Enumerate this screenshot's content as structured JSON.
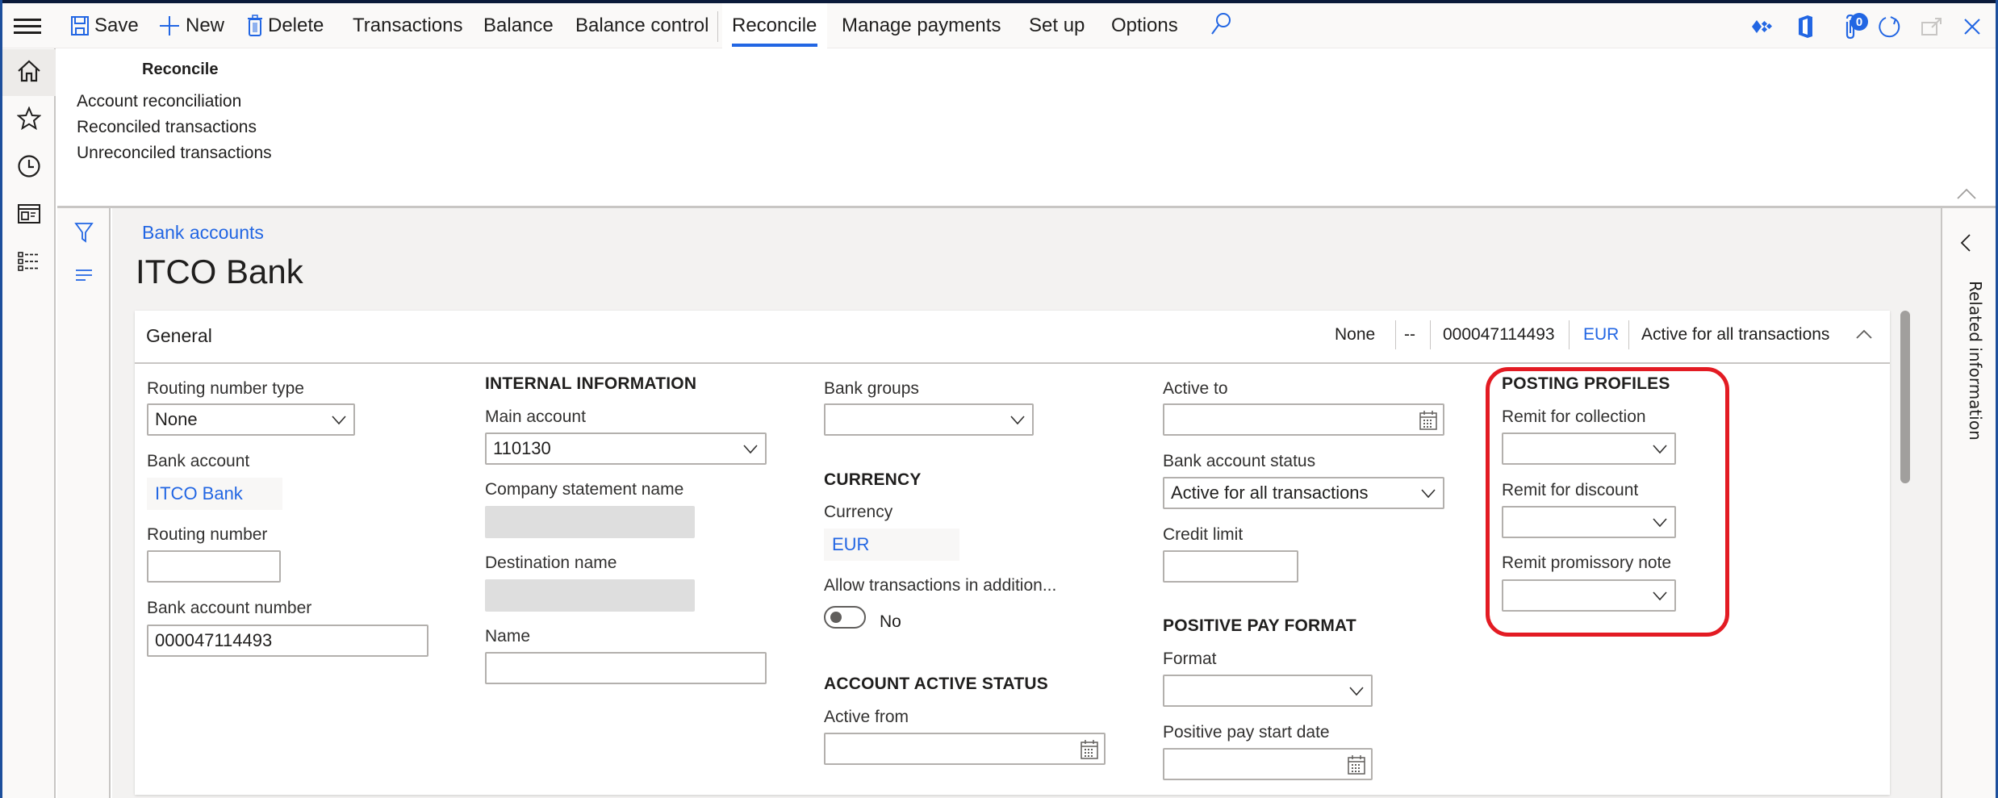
{
  "toolbar": {
    "save": "Save",
    "new": "New",
    "delete": "Delete",
    "transactions": "Transactions",
    "balance": "Balance",
    "balance_control": "Balance control",
    "reconcile": "Reconcile",
    "manage_payments": "Manage payments",
    "set_up": "Set up",
    "options": "Options",
    "attachments_count": "0"
  },
  "flyout": {
    "title": "Reconcile",
    "items": [
      "Account reconciliation",
      "Reconciled transactions",
      "Unreconciled transactions"
    ]
  },
  "breadcrumb": "Bank accounts",
  "page_title": "ITCO Bank",
  "general": {
    "title": "General",
    "summary": [
      "None",
      "--",
      "000047114493",
      "EUR",
      "Active for all transactions"
    ]
  },
  "fields": {
    "routing_number_type": {
      "label": "Routing number type",
      "value": "None"
    },
    "bank_account": {
      "label": "Bank account",
      "value": "ITCO Bank"
    },
    "routing_number": {
      "label": "Routing number",
      "value": ""
    },
    "bank_account_number": {
      "label": "Bank account number",
      "value": "000047114493"
    },
    "internal_information": "INTERNAL INFORMATION",
    "main_account": {
      "label": "Main account",
      "value": "110130"
    },
    "company_statement_name": {
      "label": "Company statement name",
      "value": ""
    },
    "destination_name": {
      "label": "Destination name",
      "value": ""
    },
    "name": {
      "label": "Name",
      "value": ""
    },
    "bank_groups": {
      "label": "Bank groups",
      "value": ""
    },
    "currency_group": "CURRENCY",
    "currency": {
      "label": "Currency",
      "value": "EUR"
    },
    "allow_transactions": {
      "label": "Allow transactions in addition...",
      "value": "No"
    },
    "account_active_status": "ACCOUNT ACTIVE STATUS",
    "active_from": {
      "label": "Active from",
      "value": ""
    },
    "active_to": {
      "label": "Active to",
      "value": ""
    },
    "bank_account_status": {
      "label": "Bank account status",
      "value": "Active for all transactions"
    },
    "credit_limit": {
      "label": "Credit limit",
      "value": ""
    },
    "positive_pay_format": "POSITIVE PAY FORMAT",
    "format": {
      "label": "Format",
      "value": ""
    },
    "positive_pay_start_date": {
      "label": "Positive pay start date",
      "value": ""
    },
    "posting_profiles": "POSTING PROFILES",
    "remit_for_collection": {
      "label": "Remit for collection",
      "value": ""
    },
    "remit_for_discount": {
      "label": "Remit for discount",
      "value": ""
    },
    "remit_promissory_note": {
      "label": "Remit promissory note",
      "value": ""
    }
  },
  "right_panel": {
    "label": "Related information"
  },
  "colors": {
    "accent": "#2266e3",
    "highlight": "#e31b23"
  }
}
